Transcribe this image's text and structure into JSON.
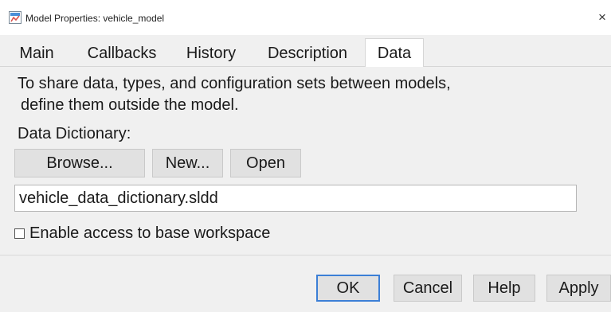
{
  "window": {
    "title": "Model Properties: vehicle_model",
    "close_glyph": "×"
  },
  "tabs": [
    {
      "label": "Main",
      "active": false
    },
    {
      "label": "Callbacks",
      "active": false
    },
    {
      "label": "History",
      "active": false
    },
    {
      "label": "Description",
      "active": false
    },
    {
      "label": "Data",
      "active": true
    }
  ],
  "data_tab": {
    "description_line1": "To share data, types, and configuration sets between models,",
    "description_line2": "define them outside the model.",
    "dictionary_label": "Data Dictionary:",
    "browse_label": "Browse...",
    "new_label": "New...",
    "open_label": "Open",
    "dictionary_value": "vehicle_data_dictionary.sldd",
    "base_workspace_checkbox_label": "Enable access to base workspace",
    "base_workspace_checked": false
  },
  "footer": {
    "ok_label": "OK",
    "cancel_label": "Cancel",
    "help_label": "Help",
    "apply_label": "Apply"
  },
  "colors": {
    "panel_background": "#f0f0f0",
    "button_face": "#e1e1e1",
    "default_button_border": "#3c7fd6"
  },
  "icons": {
    "app_icon": "simulink-model-icon",
    "close_icon": "close-icon"
  }
}
